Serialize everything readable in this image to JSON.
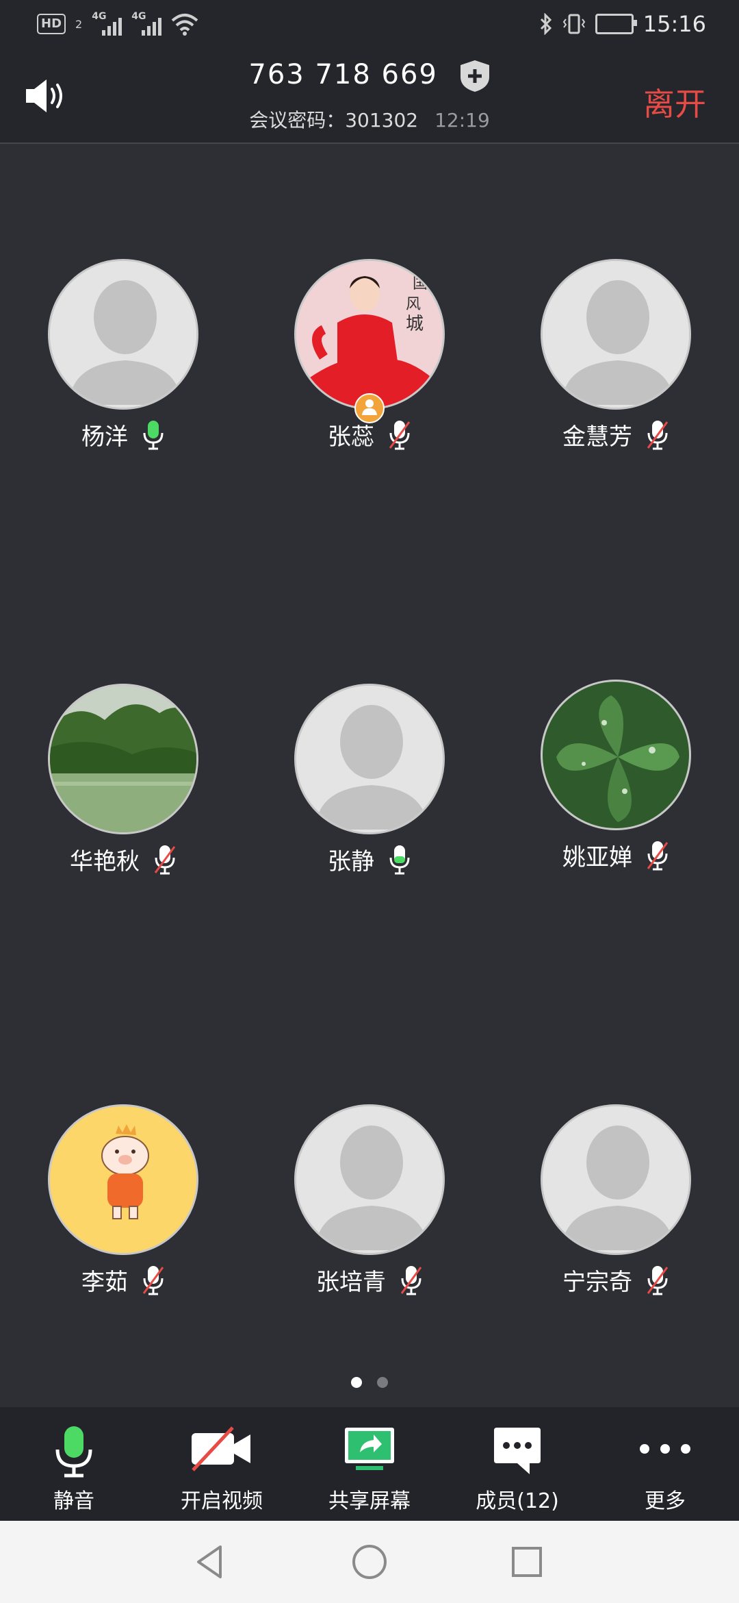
{
  "status_bar": {
    "hd_label": "HD",
    "sim_label": "2",
    "net1_label": "4G",
    "net2_label": "4G",
    "time": "15:16"
  },
  "header": {
    "meeting_id": "763 718 669",
    "password_label": "会议密码：",
    "password": "301302",
    "duration": "12:19",
    "leave_label": "离开"
  },
  "participants": [
    {
      "name": "杨洋",
      "mic": "on",
      "avatar": "placeholder"
    },
    {
      "name": "张蕊",
      "mic": "off",
      "avatar": "photo-girl-red",
      "host": true
    },
    {
      "name": "金慧芳",
      "mic": "off",
      "avatar": "placeholder"
    },
    {
      "name": "华艳秋",
      "mic": "off",
      "avatar": "photo-lake"
    },
    {
      "name": "张静",
      "mic": "on",
      "avatar": "placeholder"
    },
    {
      "name": "姚亚婵",
      "mic": "off",
      "avatar": "photo-clover"
    },
    {
      "name": "李茹",
      "mic": "off",
      "avatar": "pig-cartoon"
    },
    {
      "name": "张培青",
      "mic": "off",
      "avatar": "placeholder"
    },
    {
      "name": "宁宗奇",
      "mic": "off",
      "avatar": "placeholder"
    }
  ],
  "pagination": {
    "current": 1,
    "total": 2
  },
  "toolbar": {
    "mute_label": "静音",
    "video_label": "开启视频",
    "share_label": "共享屏幕",
    "members_label": "成员(12)",
    "more_label": "更多"
  },
  "colors": {
    "background": "#2e2f34",
    "header": "#25262b",
    "leave": "#e74b46",
    "mic_active": "#4cd964",
    "mic_muted_slash": "#e74b46",
    "host_badge": "#f2a43a"
  }
}
